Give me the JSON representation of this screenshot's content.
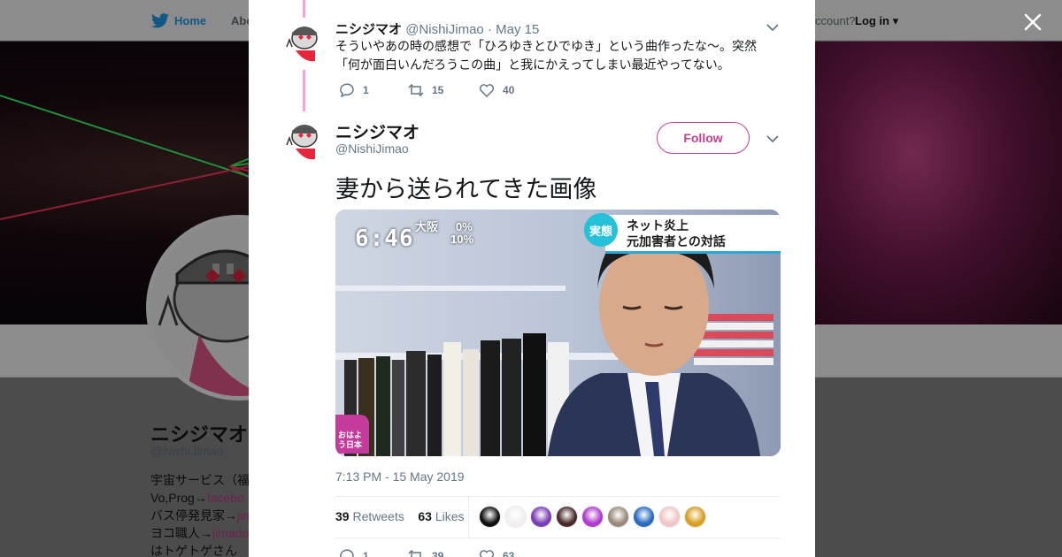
{
  "nav": {
    "home": "Home",
    "about": "Abo",
    "account_text": "ccount?",
    "login": "Log in"
  },
  "profile": {
    "name": "ニシジマオ",
    "handle": "@NishiJimao",
    "bio_lines": [
      {
        "text": "宇宙サービス（福",
        "link": ""
      },
      {
        "text": "Vo,Prog→",
        "link": "facebo"
      },
      {
        "text": "バス停発見家→",
        "link": "jim"
      },
      {
        "text": "ヨコ職人→",
        "link": "jimado"
      },
      {
        "text": "はトゲトゲさん",
        "link": ""
      }
    ]
  },
  "modal": {
    "thread_tweet": {
      "name": "ニシジマオ",
      "handle": "@NishiJimao",
      "date": "· May 15",
      "text": "そういやあの時の感想で「ひろゆきとひでゆき」という曲作ったな～。突然「何が面白いんだろうこの曲」と我にかえってしまい最近やってない。",
      "replies": "1",
      "retweets": "15",
      "likes": "40"
    },
    "main_tweet": {
      "name": "ニシジマオ",
      "handle": "@NishiJimao",
      "follow_label": "Follow",
      "text": "妻から送られてきた画像",
      "timestamp": "7:13 PM - 15 May 2019",
      "retweet_count": "39",
      "retweet_label": "Retweets",
      "like_count": "63",
      "like_label": "Likes",
      "replies": "1",
      "retweets": "39",
      "likes": "63",
      "photo": {
        "clock": "6:46",
        "city": "大阪",
        "rain_a": "0%",
        "rain_b": "10%",
        "badge": "実態",
        "caption_line1": "ネット炎上",
        "caption_line2": "元加害者との対話",
        "logo": "おはよう日本"
      }
    }
  },
  "colors": {
    "accent": "#c3408f",
    "thread_line": "#f4a3dc",
    "twitter_blue": "#1da1f2",
    "text_primary": "#14171a",
    "text_secondary": "#657786"
  },
  "liker_colors": [
    "#111111",
    "#f0f0f0",
    "#7a3cb8",
    "#4a2a2a",
    "#b03ad0",
    "#9a8a7a",
    "#2a6ac0",
    "#f2c6c6",
    "#d8a020"
  ]
}
